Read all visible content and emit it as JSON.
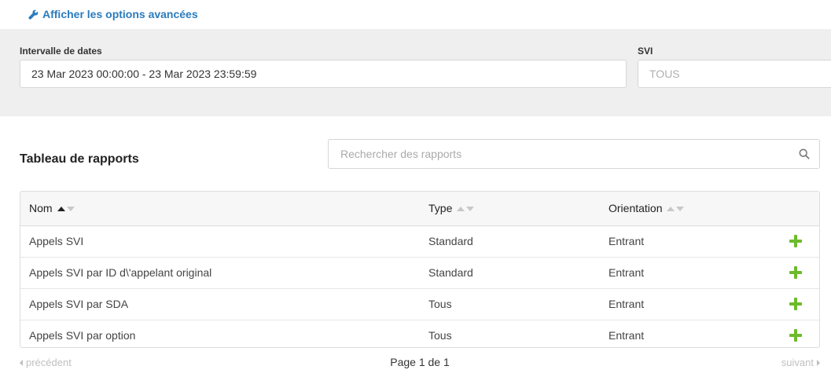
{
  "advanced_link": {
    "label": "Afficher les options avancées",
    "icon": "wrench-icon",
    "color": "#2a7bbd"
  },
  "filters": {
    "date_range": {
      "label": "Intervalle de dates",
      "value": "23 Mar 2023 00:00:00 - 23 Mar 2023 23:59:59"
    },
    "ivr": {
      "label": "SVI",
      "placeholder": "TOUS"
    }
  },
  "reports": {
    "title": "Tableau de rapports",
    "search_placeholder": "Rechercher des rapports",
    "columns": [
      {
        "label": "Nom",
        "sort": "asc"
      },
      {
        "label": "Type",
        "sort": "none"
      },
      {
        "label": "Orientation",
        "sort": "none"
      }
    ],
    "rows": [
      {
        "name": "Appels SVI",
        "type": "Standard",
        "orientation": "Entrant"
      },
      {
        "name": "Appels SVI par ID d\\'appelant original",
        "type": "Standard",
        "orientation": "Entrant"
      },
      {
        "name": "Appels SVI par SDA",
        "type": "Tous",
        "orientation": "Entrant"
      },
      {
        "name": "Appels SVI par option",
        "type": "Tous",
        "orientation": "Entrant"
      }
    ],
    "add_icon": "plus-icon",
    "add_color": "#6dbb2b"
  },
  "pagination": {
    "prev": "précédent",
    "info": "Page 1 de 1",
    "next": "suivant"
  }
}
